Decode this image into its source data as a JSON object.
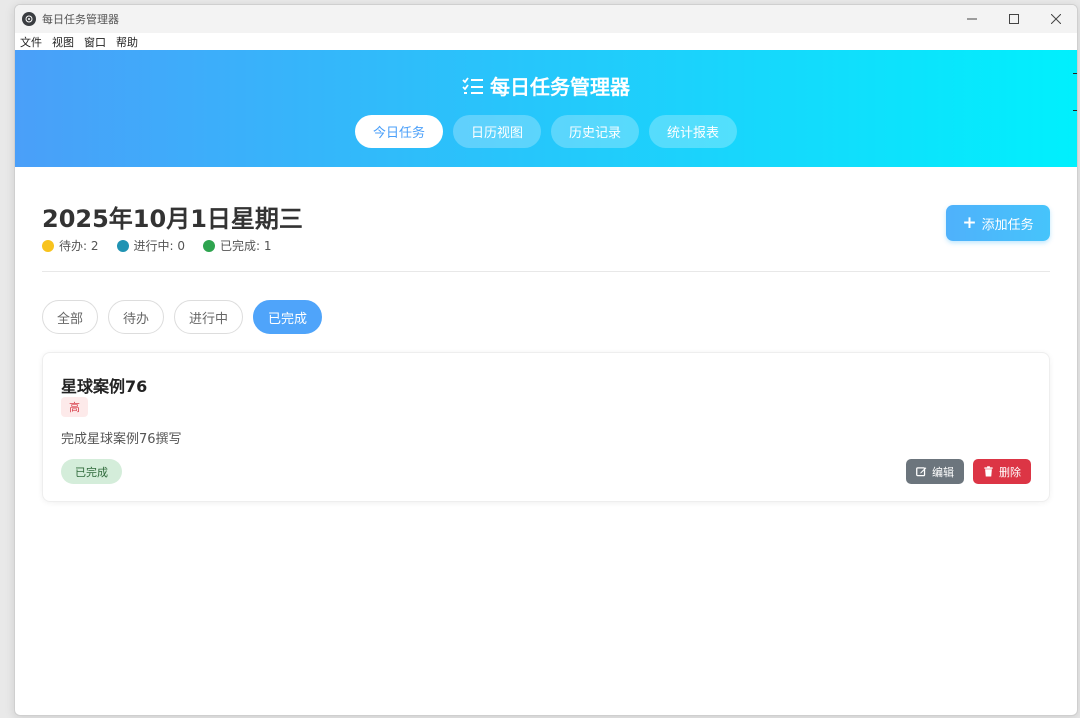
{
  "window": {
    "title": "每日任务管理器"
  },
  "menu": {
    "items": [
      "文件",
      "视图",
      "窗口",
      "帮助"
    ]
  },
  "header": {
    "title": "每日任务管理器"
  },
  "tabs": [
    {
      "label": "今日任务",
      "active": true
    },
    {
      "label": "日历视图",
      "active": false
    },
    {
      "label": "历史记录",
      "active": false
    },
    {
      "label": "统计报表",
      "active": false
    }
  ],
  "main": {
    "date_title": "2025年10月1日星期三",
    "stats": [
      {
        "label": "待办: 2",
        "color": "#f8c31d"
      },
      {
        "label": "进行中: 0",
        "color": "#2093b3"
      },
      {
        "label": "已完成: 1",
        "color": "#2ea44f"
      }
    ],
    "add_button": "添加任务",
    "filters": [
      {
        "label": "全部",
        "active": false
      },
      {
        "label": "待办",
        "active": false
      },
      {
        "label": "进行中",
        "active": false
      },
      {
        "label": "已完成",
        "active": true
      }
    ]
  },
  "task": {
    "title": "星球案例76",
    "priority": "高",
    "description": "完成星球案例76撰写",
    "status": "已完成",
    "edit_label": "编辑",
    "delete_label": "删除"
  },
  "colors": {
    "accent": "#4a9ff9",
    "gradient_end": "#00f0fd",
    "danger": "#dc3545",
    "secondary": "#6c757d"
  }
}
